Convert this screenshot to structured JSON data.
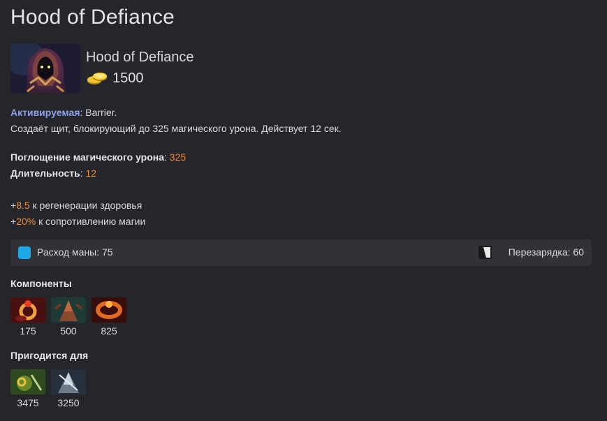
{
  "page": {
    "title": "Hood of Defiance"
  },
  "item": {
    "name": "Hood of Defiance",
    "cost": "1500",
    "gold_icon": "gold-coins-icon"
  },
  "active": {
    "label": "Активируемая",
    "name": "Barrier.",
    "description": "Создаёт щит, блокирующий до 325 магического урона. Действует 12 сек."
  },
  "stats": [
    {
      "label": "Поглощение магического урона",
      "value": "325"
    },
    {
      "label": "Длительность",
      "value": "12"
    }
  ],
  "bonuses": [
    {
      "value": "8.5",
      "text": "к регенерации здоровья"
    },
    {
      "value": "20%",
      "text": "к сопротивлению магии"
    }
  ],
  "costs": {
    "mana_label": "Расход маны: 75",
    "cooldown_label": "Перезарядка: 60",
    "mana_color": "#1ea8e6",
    "mana_icon": "mana-icon",
    "cooldown_icon": "cooldown-icon"
  },
  "components": {
    "title": "Компоненты",
    "items": [
      {
        "cost": "175",
        "icon": "ring-of-health-icon"
      },
      {
        "cost": "500",
        "icon": "cloak-icon"
      },
      {
        "cost": "825",
        "icon": "ring-of-regen-icon"
      }
    ]
  },
  "upgrades": {
    "title": "Пригодится для",
    "items": [
      {
        "cost": "3475",
        "icon": "upgrade-item-green-icon"
      },
      {
        "cost": "3250",
        "icon": "pipe-of-insight-icon"
      }
    ]
  },
  "colors": {
    "accent_orange": "#ee8c3a",
    "active_label": "#8f9ee8",
    "background": "#25262b"
  }
}
